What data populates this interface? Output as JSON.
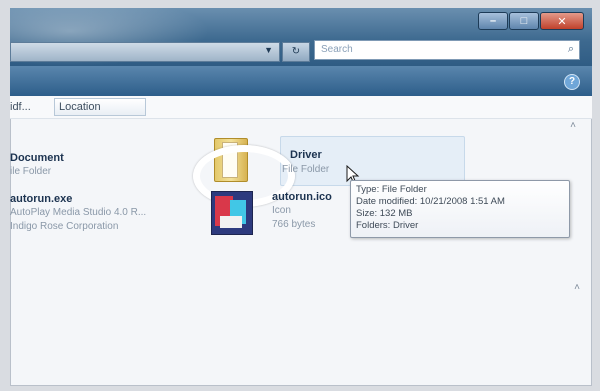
{
  "header": {
    "search_placeholder": "Search",
    "help_label": "?",
    "window_controls": {
      "minimize": "–",
      "maximize": "□",
      "close": "✕"
    }
  },
  "columns": {
    "first": "idf...",
    "second": "Location"
  },
  "items": [
    {
      "name": "Document",
      "type": "ile Folder"
    },
    {
      "name": "Driver",
      "type": "File Folder"
    },
    {
      "name": "autorun.exe",
      "desc": "AutoPlay Media Studio 4.0 R...",
      "company": "Indigo Rose Corporation"
    },
    {
      "name": "autorun.ico",
      "type": "Icon",
      "size": "766 bytes"
    }
  ],
  "tooltip": {
    "type": "Type: File Folder",
    "date": "Date modified: 10/21/2008 1:51 AM",
    "size": "Size: 132 MB",
    "folders": "Folders: Driver"
  },
  "icons": [
    "search-icon",
    "refresh-icon",
    "dropdown-icon",
    "folder-icon",
    "app-icon",
    "cursor-icon",
    "help-icon"
  ],
  "colors": {
    "title_bar": "#3e6a90",
    "highlight": "#e5eef7",
    "tooltip_border": "#8e99a8"
  }
}
